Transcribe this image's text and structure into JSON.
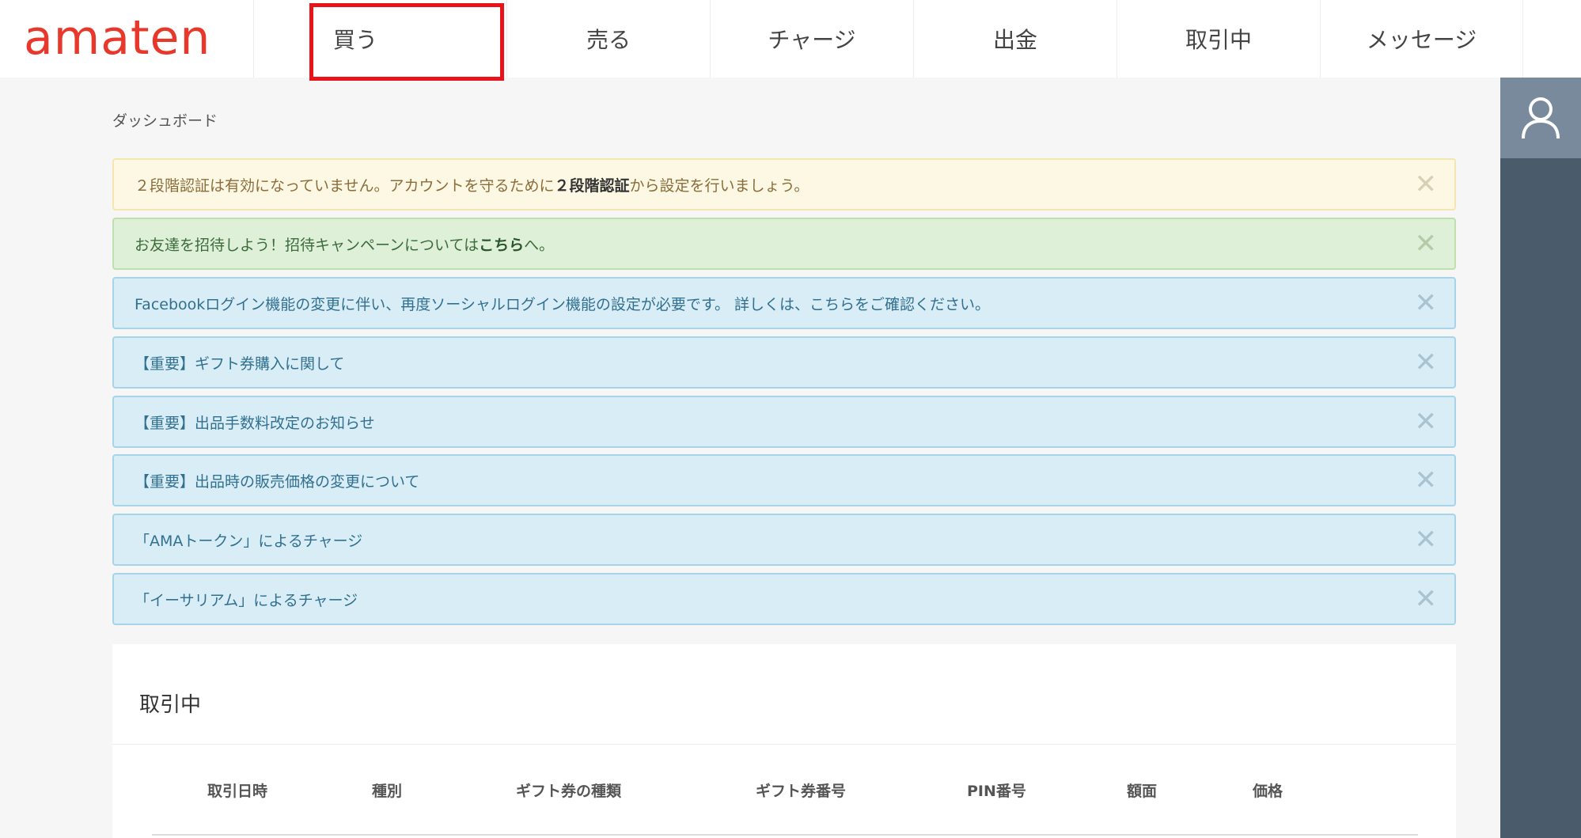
{
  "header": {
    "logo_text": "amaten",
    "nav": [
      {
        "label": "買う"
      },
      {
        "label": "売る"
      },
      {
        "label": "チャージ"
      },
      {
        "label": "出金"
      },
      {
        "label": "取引中"
      },
      {
        "label": "メッセージ"
      }
    ]
  },
  "breadcrumb": "ダッシュボード",
  "alerts": {
    "two_factor": {
      "before": "２段階認証は有効になっていません。アカウントを守るために",
      "link": "２段階認証",
      "after": "から設定を行いましょう。"
    },
    "invite": {
      "before": "お友達を招待しよう！招待キャンペーンについては",
      "link": "こちら",
      "after": "へ。"
    },
    "facebook": "Facebookログイン機能の変更に伴い、再度ソーシャルログイン機能の設定が必要です。 詳しくは、こちらをご確認ください。",
    "notice1": "【重要】ギフト券購入に関して",
    "notice2": "【重要】出品手数料改定のお知らせ",
    "notice3": "【重要】出品時の販売価格の変更について",
    "notice4": "「AMAトークン」によるチャージ",
    "notice5": "「イーサリアム」によるチャージ",
    "close_glyph": "✕"
  },
  "trading": {
    "title": "取引中",
    "columns": [
      "取引日時",
      "種別",
      "ギフト券の種類",
      "ギフト券番号",
      "PIN番号",
      "額面",
      "価格"
    ]
  }
}
